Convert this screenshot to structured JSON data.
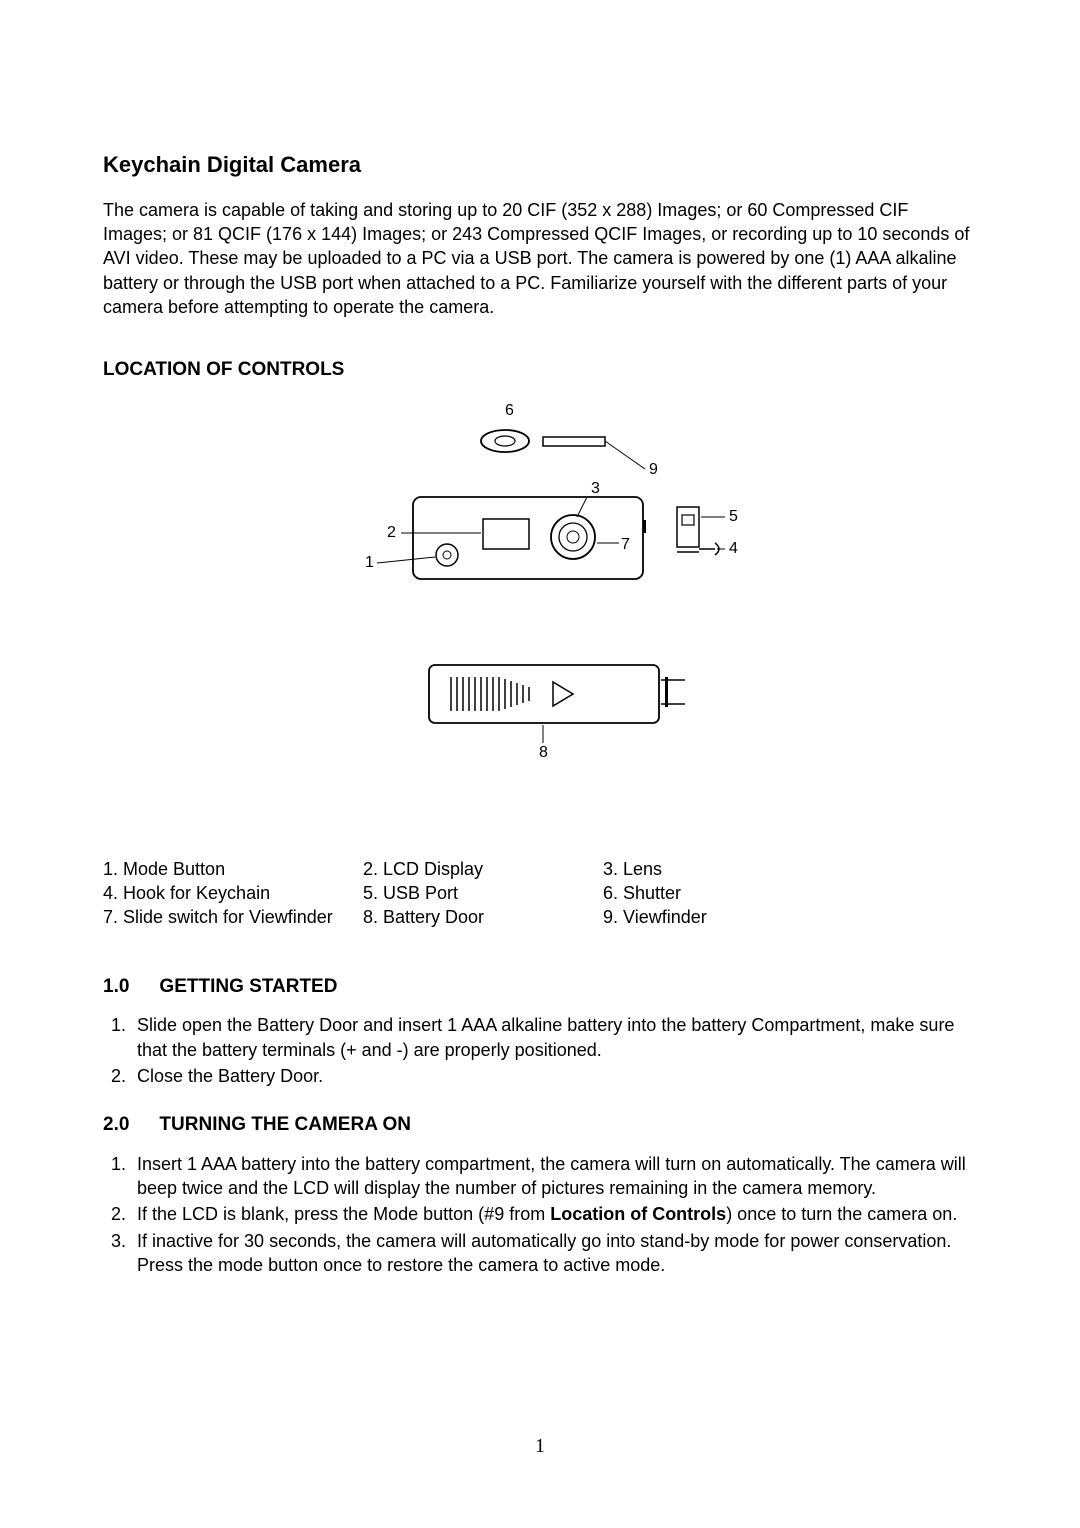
{
  "title": "Keychain Digital Camera",
  "intro": "The camera is capable of taking and storing up to 20 CIF (352 x 288) Images; or 60 Compressed CIF Images; or 81 QCIF (176 x 144) Images; or 243 Compressed QCIF Images, or recording up to 10 seconds of AVI video.   These may be uploaded to a PC via a USB port.    The camera is powered by one (1) AAA alkaline battery or through the USB port when attached to a PC.  Familiarize yourself with the different parts of your camera before attempting to operate the camera.",
  "location_heading": "LOCATION OF CONTROLS",
  "controls": {
    "c1": "1. Mode Button",
    "c2": "2.  LCD Display",
    "c3": "3. Lens",
    "c4": "4. Hook for Keychain",
    "c5": "5.  USB Port",
    "c6": "6. Shutter",
    "c7": "7. Slide switch for Viewfinder",
    "c8": "8.  Battery Door",
    "c9": "9. Viewfinder"
  },
  "sec1": {
    "num": "1.0",
    "title": "GETTING STARTED"
  },
  "sec1_items": {
    "i1": "Slide open the Battery Door and insert 1 AAA alkaline battery into the battery Compartment, make sure that the battery terminals (+ and -) are properly positioned.",
    "i2": "Close the Battery Door."
  },
  "sec2": {
    "num": "2.0",
    "title": "TURNING THE CAMERA ON"
  },
  "sec2_items": {
    "i1": "Insert 1 AAA battery into the battery compartment, the camera will turn on automatically.   The camera will beep twice and the LCD will display the number of pictures remaining in the camera memory.",
    "i2a": "If the LCD is blank, press the Mode button (#9 from ",
    "i2b": "Location of Controls",
    "i2c": ") once to turn the camera on.",
    "i3": "If inactive for 30 seconds, the camera will automatically go into stand-by mode for power conservation.  Press the mode button once to restore the camera to active mode."
  },
  "page_number": "1",
  "diagram_labels": {
    "n1": "1",
    "n2": "2",
    "n3": "3",
    "n4": "4",
    "n5": "5",
    "n6": "6",
    "n7": "7",
    "n8": "8",
    "n9": "9"
  }
}
